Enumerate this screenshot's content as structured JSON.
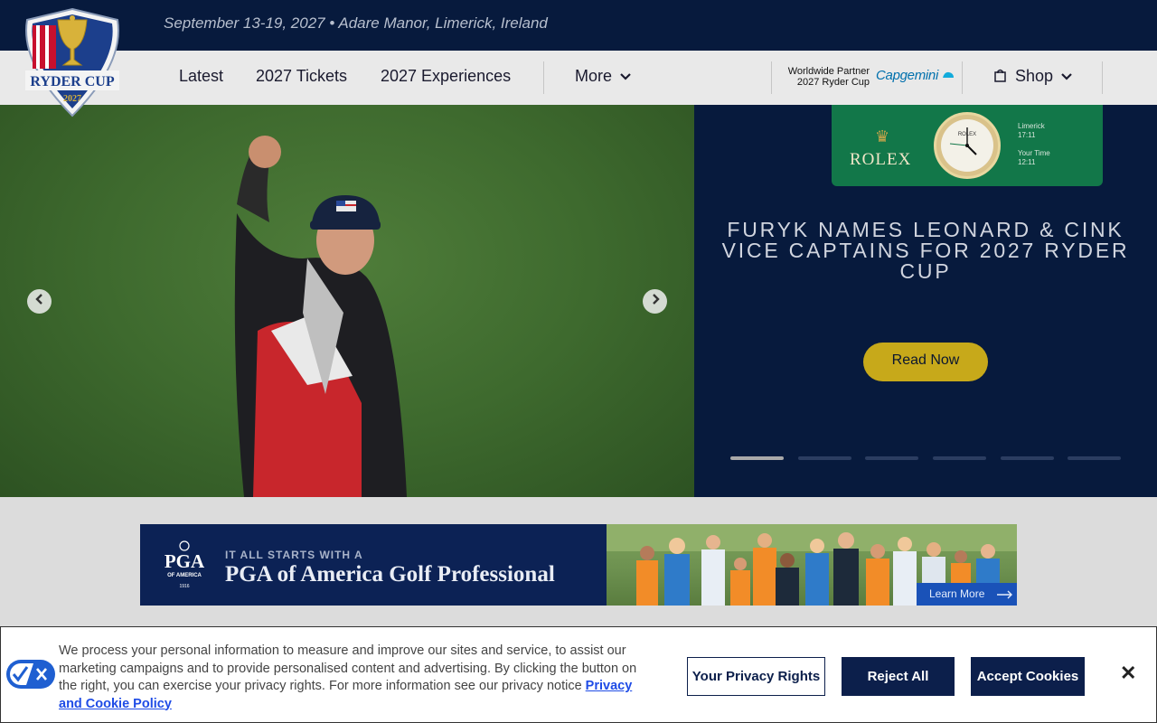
{
  "topbar": {
    "event_info": "September 13-19, 2027  •  Adare Manor, Limerick, Ireland"
  },
  "logo": {
    "name": "RYDER CUP",
    "year": "2027"
  },
  "nav": {
    "items": [
      "Latest",
      "2027 Tickets",
      "2027 Experiences",
      "More"
    ],
    "partner_line1": "Worldwide Partner",
    "partner_line2": "2027 Ryder Cup",
    "partner_brand": "Capgemini",
    "shop": "Shop"
  },
  "hero": {
    "rolex": {
      "brand": "ROLEX",
      "clock_label": "ROLEX",
      "location_label": "Limerick",
      "location_time": "17:11",
      "your_time_label": "Your Time",
      "your_time": "12:11"
    },
    "headline": "FURYK NAMES LEONARD & CINK VICE CAPTAINS FOR 2027 RYDER CUP",
    "cta": "Read Now",
    "slide_count": 6,
    "active_slide": 1
  },
  "ad": {
    "logo_text": "PGA",
    "logo_sub": "OF AMERICA",
    "logo_year": "1916",
    "kicker": "IT ALL STARTS WITH A",
    "title": "PGA of America Golf Professional",
    "cta": "Learn More"
  },
  "cookie": {
    "text": "We process your personal information to measure and improve our sites and service, to assist our marketing campaigns and to provide personalised content and advertising. By clicking the button on the right, you can exercise your privacy rights. For more information see our privacy notice",
    "link": "Privacy and Cookie Policy",
    "btn_rights": "Your Privacy Rights",
    "btn_reject": "Reject All",
    "btn_accept": "Accept Cookies",
    "close": "✕"
  },
  "colors": {
    "navy": "#071a3d",
    "gold": "#c7a91a",
    "rolex_green": "#127749",
    "cookie_navy": "#0c1f4b"
  }
}
